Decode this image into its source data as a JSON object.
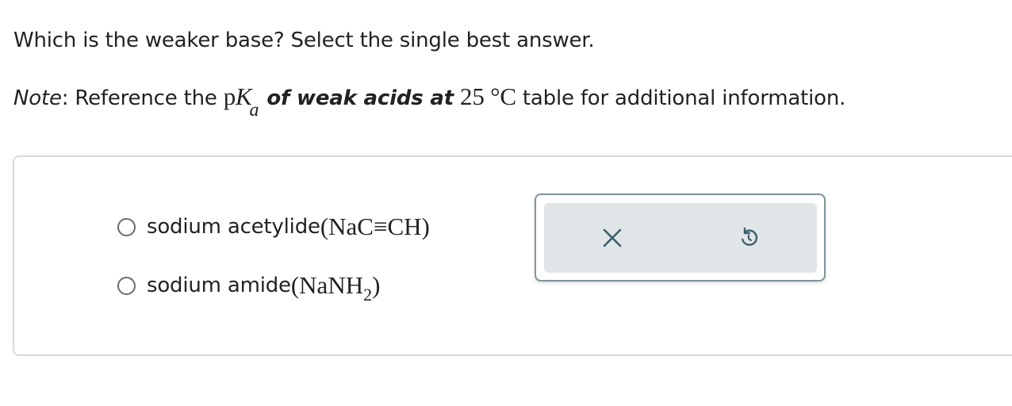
{
  "question": {
    "text": "Which is the weaker base? Select the single best answer."
  },
  "note": {
    "label": "Note",
    "colon": ":",
    "prefix": " Reference the ",
    "pK_p": "p",
    "pK_K": "K",
    "pK_sub": "a",
    "link_text": "of weak acids at",
    "temperature": "25 °C",
    "suffix": " table for additional information."
  },
  "options": [
    {
      "label": "sodium acetylide ",
      "formula": "(NaC≡CH)",
      "selected": false
    },
    {
      "label": "sodium amide ",
      "formula_main": "(NaNH",
      "formula_sub": "2",
      "formula_end": ")",
      "selected": false
    }
  ],
  "tools": {
    "clear_icon": "close-icon",
    "undo_icon": "undo-icon",
    "icon_color": "#3d5f6b"
  }
}
